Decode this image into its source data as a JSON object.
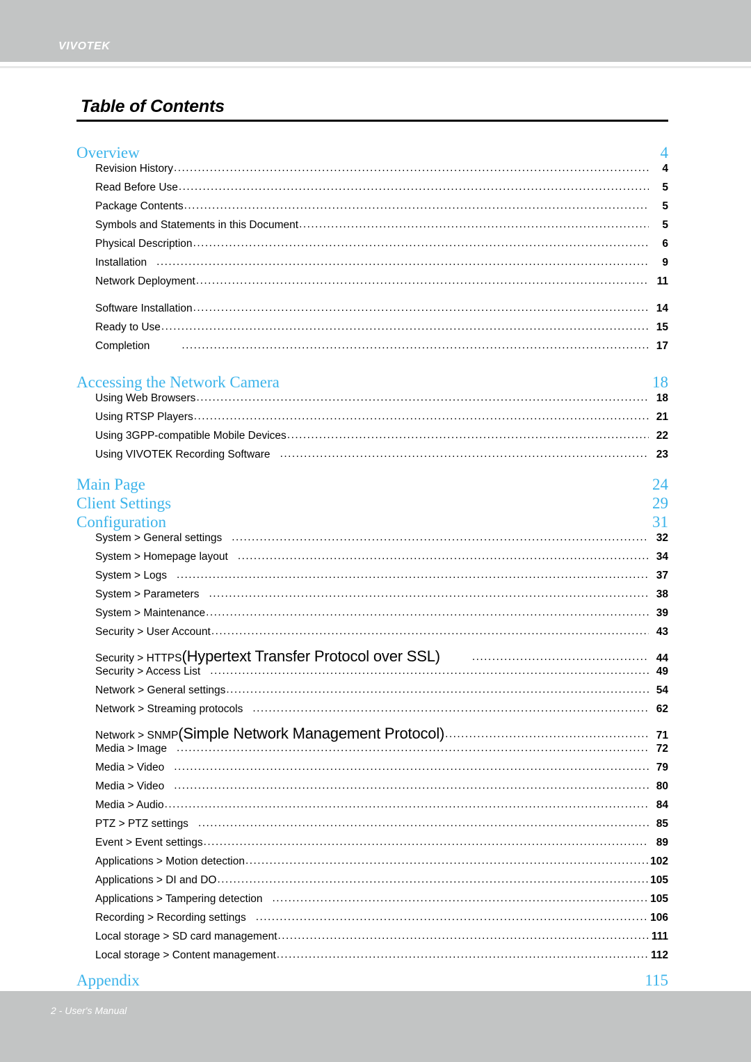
{
  "header": {
    "brand": "VIVOTEK"
  },
  "page_title": "Table of Contents",
  "footer": {
    "text": "2 - User's Manual"
  },
  "toc": {
    "sections": [
      {
        "heading": {
          "label": "Overview",
          "page": "4"
        },
        "entries": [
          {
            "label": "Revision History",
            "page": "4"
          },
          {
            "label": "Read Before Use",
            "page": "5"
          },
          {
            "label": "Package Contents",
            "page": "5"
          },
          {
            "label": "Symbols and Statements in this Document",
            "page": "5"
          },
          {
            "label": "Physical Description",
            "page": "6"
          },
          {
            "label": "Installation",
            "page": "9"
          },
          {
            "label": "Network Deployment",
            "page": "11"
          },
          {
            "label": "Software Installation",
            "page": "14"
          },
          {
            "label": "Ready to Use",
            "page": "15"
          },
          {
            "label": "Completion",
            "page": "17"
          }
        ]
      },
      {
        "heading": {
          "label": "Accessing the Network Camera",
          "page": "18"
        },
        "entries": [
          {
            "label": "Using Web Browsers",
            "page": "18"
          },
          {
            "label": "Using RTSP Players",
            "page": "21"
          },
          {
            "label": "Using 3GPP-compatible Mobile Devices",
            "page": "22"
          },
          {
            "label": "Using VIVOTEK Recording Software",
            "page": "23"
          }
        ]
      },
      {
        "heading": {
          "label": "Main Page",
          "page": "24"
        },
        "entries": []
      },
      {
        "heading": {
          "label": "Client Settings",
          "page": "29"
        },
        "entries": []
      },
      {
        "heading": {
          "label": "Configuration",
          "page": "31"
        },
        "entries": [
          {
            "label": "System > General settings",
            "page": "32"
          },
          {
            "label": "System > Homepage layout",
            "page": "34"
          },
          {
            "label": "System > Logs",
            "page": "37"
          },
          {
            "label": "System > Parameters",
            "page": "38"
          },
          {
            "label": "System > Maintenance",
            "page": "39"
          },
          {
            "label": "Security > User Account",
            "page": "43"
          },
          {
            "label": "Security >  HTTPS ",
            "label_big": "(Hypertext Transfer Protocol over SSL)",
            "page": "44"
          },
          {
            "label": "Security >  Access List ",
            "page": "49"
          },
          {
            "label": "Network > General settings",
            "page": "54"
          },
          {
            "label": "Network > Streaming protocols ",
            "page": "62"
          },
          {
            "label": "Network > SNMP ",
            "label_big": "(Simple Network Management Protocol)",
            "page": "71"
          },
          {
            "label": "Media > Image ",
            "page": "72"
          },
          {
            "label": "Media > Video",
            "page": "79"
          },
          {
            "label": "Media > Video ",
            "page": "80"
          },
          {
            "label": "Media > Audio",
            "page": "84"
          },
          {
            "label": "PTZ > PTZ settings",
            "page": "85"
          },
          {
            "label": "Event > Event settings",
            "page": "89"
          },
          {
            "label": "Applications > Motion detection",
            "page": "102"
          },
          {
            "label": "Applications > DI and DO",
            "page": "105"
          },
          {
            "label": "Applications > Tampering detection",
            "page": "105"
          },
          {
            "label": "Recording > Recording settings",
            "page": "106"
          },
          {
            "label": "Local storage > SD card management",
            "page": "111"
          },
          {
            "label": "Local storage > Content management",
            "page": "112"
          }
        ]
      },
      {
        "heading": {
          "label": "Appendix",
          "page": "115"
        },
        "entries": []
      }
    ]
  },
  "colors": {
    "heading_blue": "#3bb3ea",
    "bar_gray": "#c2c4c4",
    "rule_gray": "#e7e8e8",
    "text_black": "#000000"
  }
}
